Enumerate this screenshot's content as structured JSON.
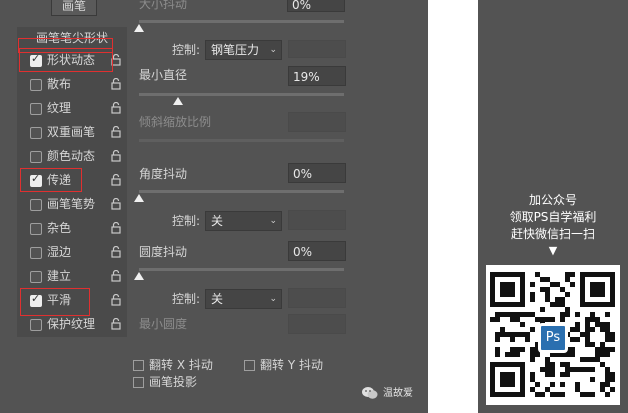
{
  "header": {
    "button_label": "画笔",
    "top_label": "大小抖动",
    "top_value": "0%"
  },
  "section_title": "画笔笔尖形状",
  "list": [
    {
      "label": "形状动态",
      "checked": true,
      "highlighted": true
    },
    {
      "label": "散布",
      "checked": false,
      "highlighted": false
    },
    {
      "label": "纹理",
      "checked": false,
      "highlighted": false
    },
    {
      "label": "双重画笔",
      "checked": false,
      "highlighted": false
    },
    {
      "label": "颜色动态",
      "checked": false,
      "highlighted": false
    },
    {
      "label": "传递",
      "checked": true,
      "highlighted": true
    },
    {
      "label": "画笔笔势",
      "checked": false,
      "highlighted": false
    },
    {
      "label": "杂色",
      "checked": false,
      "highlighted": false
    },
    {
      "label": "湿边",
      "checked": false,
      "highlighted": false
    },
    {
      "label": "建立",
      "checked": false,
      "highlighted": false
    },
    {
      "label": "平滑",
      "checked": true,
      "highlighted": true
    },
    {
      "label": "保护纹理",
      "checked": false,
      "highlighted": false
    }
  ],
  "controls": {
    "control_label_1": "控制:",
    "control_value_1": "钢笔压力",
    "min_diameter_label": "最小直径",
    "min_diameter_value": "19%",
    "min_diameter_level": 0.19,
    "tilt_scale_label": "倾斜缩放比例",
    "angle_jitter_label": "角度抖动",
    "angle_jitter_value": "0%",
    "control_label_2": "控制:",
    "control_value_2": "关",
    "roundness_jitter_label": "圆度抖动",
    "roundness_jitter_value": "0%",
    "control_label_3": "控制:",
    "control_value_3": "关",
    "min_roundness_label": "最小圆度",
    "flip_x_label": "翻转 X 抖动",
    "flip_y_label": "翻转 Y 抖动",
    "brush_projection_label": "画笔投影"
  },
  "promo": {
    "line1": "加公众号",
    "line2": "领取PS自学福利",
    "line3": "赶快微信扫一扫",
    "arrow": "▼",
    "qr_badge": "Ps"
  },
  "watermark": {
    "text": "温故爱"
  },
  "colors": {
    "panel": "#535353",
    "highlight": "#e03030",
    "ps_blue": "#2a6fb0"
  }
}
